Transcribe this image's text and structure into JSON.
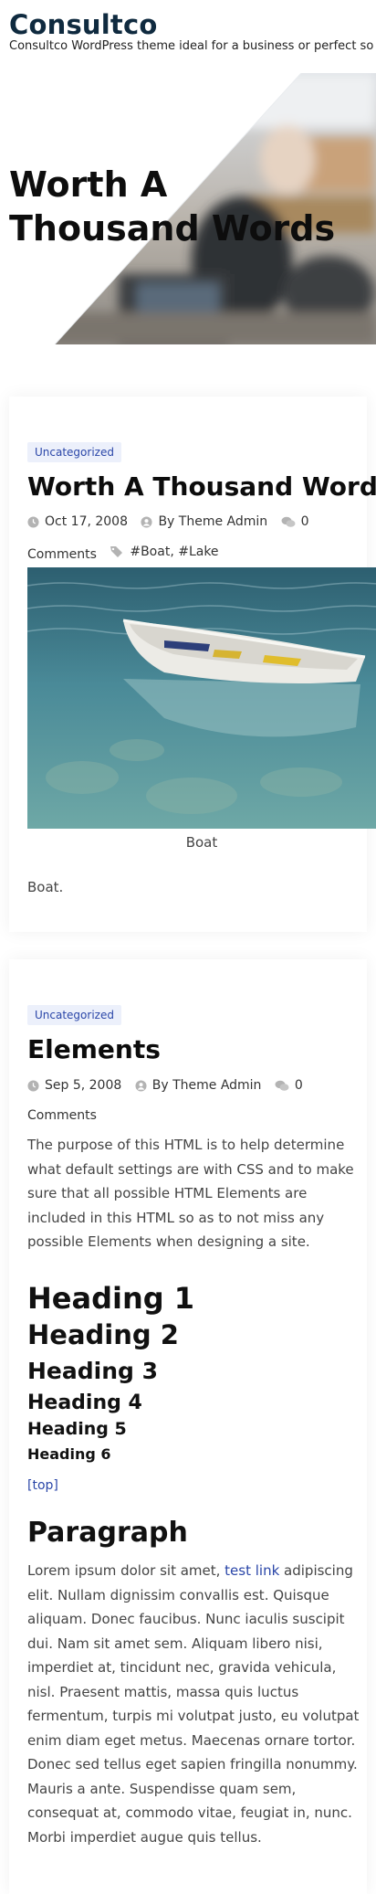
{
  "site": {
    "title": "Consultco",
    "tagline": "Consultco WordPress theme ideal for a business or perfect so"
  },
  "hero": {
    "title": "Worth A Thousand Words"
  },
  "post1": {
    "category": "Uncategorized",
    "title": "Worth A Thousand Words",
    "date": "Oct 17, 2008",
    "author": "By Theme Admin",
    "comments_count": "0",
    "comments_label": "Comments",
    "tags": "#Boat, #Lake",
    "caption": "Boat",
    "excerpt": "Boat."
  },
  "post2": {
    "category": "Uncategorized",
    "title": "Elements",
    "date": "Sep 5, 2008",
    "author": "By Theme Admin",
    "comments_count": "0",
    "comments_label": "Comments",
    "intro": "The purpose of this HTML is to help determine what default settings are with CSS and to make sure that all possible HTML Elements are included in this HTML so as to not miss any possible Elements when designing a site.",
    "headings": {
      "h1": "Heading 1",
      "h2": "Heading 2",
      "h3": "Heading 3",
      "h4": "Heading 4",
      "h5": "Heading 5",
      "h6": "Heading 6"
    },
    "top_link": "[top]",
    "paragraph_heading": "Paragraph",
    "paragraph_before": "Lorem ipsum dolor sit amet, ",
    "paragraph_link": "test link",
    "paragraph_after": " adipiscing elit. Nullam dignissim convallis est. Quisque aliquam. Donec faucibus. Nunc iaculis suscipit dui. Nam sit amet sem. Aliquam libero nisi, imperdiet at, tincidunt nec, gravida vehicula, nisl. Praesent mattis, massa quis luctus fermentum, turpis mi volutpat justo, eu volutpat enim diam eget metus. Maecenas ornare tortor. Donec sed tellus eget sapien fringilla nonummy. Mauris a ante. Suspendisse quam sem, consequat at, commodo vitae, feugiat in, nunc. Morbi imperdiet augue quis tellus."
  },
  "colors": {
    "brand_dark": "#0f2a3f",
    "link_blue": "#2a46a8",
    "badge_bg": "#ecf0fb"
  }
}
